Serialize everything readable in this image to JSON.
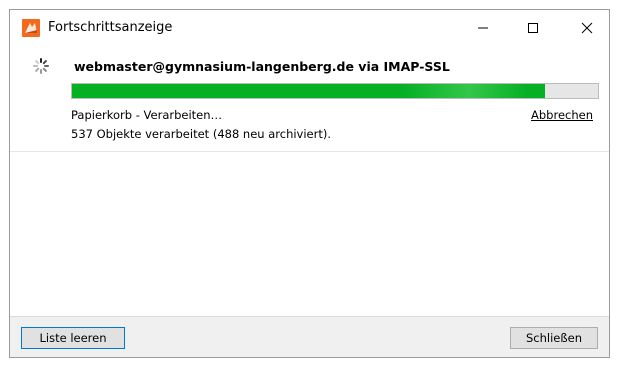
{
  "window": {
    "title": "Fortschrittsanzeige",
    "controls": {
      "minimize_icon": "minimize-icon",
      "maximize_icon": "maximize-icon",
      "close_icon": "close-icon"
    }
  },
  "task": {
    "account": "webmaster@gymnasium-langenberg.de via IMAP-SSL",
    "progress_fraction": 0.9,
    "status": "Papierkorb - Verarbeiten…",
    "detail": "537 Objekte verarbeitet (488 neu archiviert).",
    "cancel_label": "Abbrechen"
  },
  "footer": {
    "clear_list_label": "Liste leeren",
    "close_label": "Schließen"
  },
  "colors": {
    "progress": "#06b025",
    "accent": "#0078d7",
    "icon_orange": "#f26b1d"
  }
}
